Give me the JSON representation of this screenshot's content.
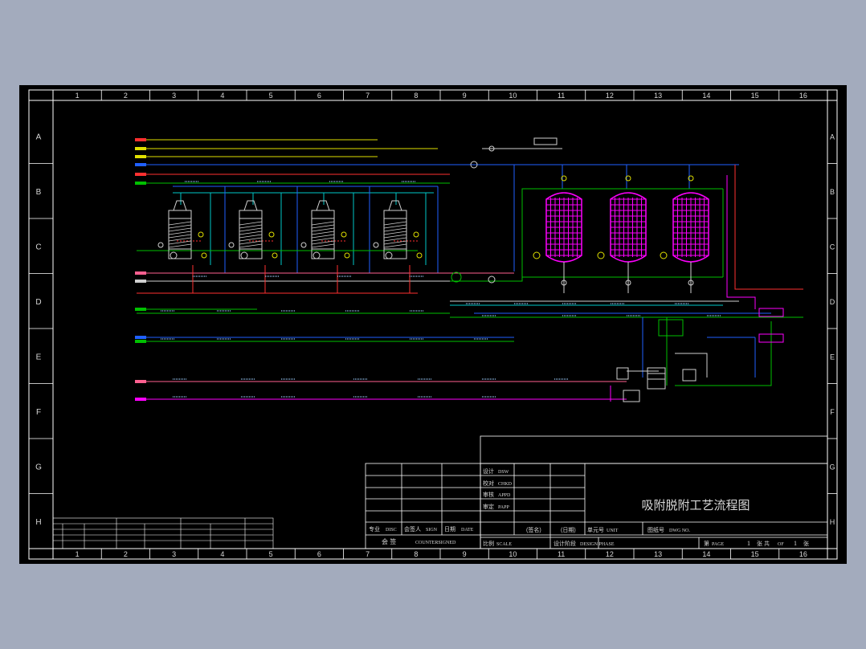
{
  "sheet": {
    "title": "吸附脱附工艺流程图",
    "columns": [
      "1",
      "2",
      "3",
      "4",
      "5",
      "6",
      "7",
      "8",
      "9",
      "10",
      "11",
      "12",
      "13",
      "14",
      "15",
      "16"
    ],
    "rows": [
      "A",
      "B",
      "C",
      "D",
      "E",
      "F",
      "G",
      "H"
    ]
  },
  "title_block": {
    "row_labels": [
      {
        "cn": "设计",
        "en": "DSW"
      },
      {
        "cn": "校对",
        "en": "CHKD"
      },
      {
        "cn": "审核",
        "en": "APPD"
      },
      {
        "cn": "审定",
        "en": "PAPP"
      }
    ],
    "discipline": {
      "cn": "专业",
      "en": "DISC"
    },
    "countersign_person": {
      "cn": "会签人",
      "en": "SIGN"
    },
    "date": {
      "cn": "日期",
      "en": "DATE"
    },
    "countersigned": {
      "cn": "会    签",
      "en": "COUNTERSIGNED"
    },
    "signature": "(签名)",
    "date_paren": "(日期)",
    "unit": {
      "cn": "单元号",
      "en": "UNIT"
    },
    "dwg_no": {
      "cn": "图纸号",
      "en": "DWG NO."
    },
    "scale": {
      "cn": "比例",
      "en": "SCALE"
    },
    "design_phase": {
      "cn": "设计阶段",
      "en": "DESIGN PHASE"
    },
    "page": {
      "cn": "第",
      "en": "PAGE",
      "num": "1",
      "of_cn": "张 共",
      "of_en": "OF",
      "total": "1",
      "end_cn": "张"
    }
  },
  "colors": {
    "background": "#a3abbd",
    "sheet": "#000000",
    "frame": "#ffffff",
    "cyan": "#00c8c8",
    "green": "#00c000",
    "yellow": "#e0e000",
    "magenta": "#ff00ff",
    "blue": "#2060ff",
    "red": "#ff3030",
    "white_line": "#d0d0d0"
  }
}
